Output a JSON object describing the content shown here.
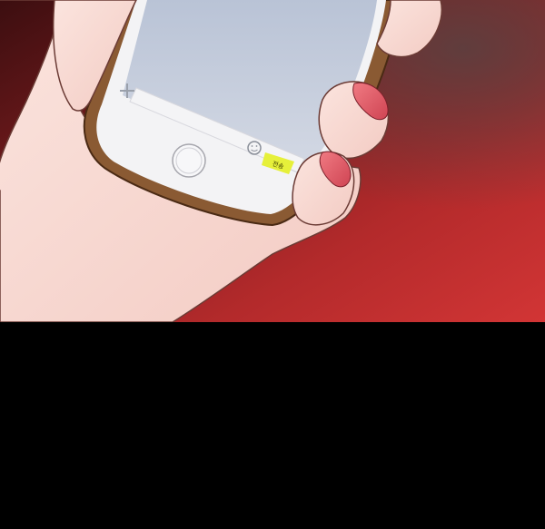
{
  "phone": {
    "send_button_label": "전송"
  },
  "icons": {
    "attach": "plus-icon",
    "emoji": "smiley-icon",
    "home": "home-button"
  },
  "colors": {
    "background_red": "#b42a2a",
    "background_dark": "#4a1214",
    "screen": "#c9d0df",
    "send_button": "#e6f03a",
    "phone_case": "#8a5a33",
    "skin": "#f9dcd6",
    "nail": "#e05a66",
    "bottom_panel": "#000000"
  }
}
